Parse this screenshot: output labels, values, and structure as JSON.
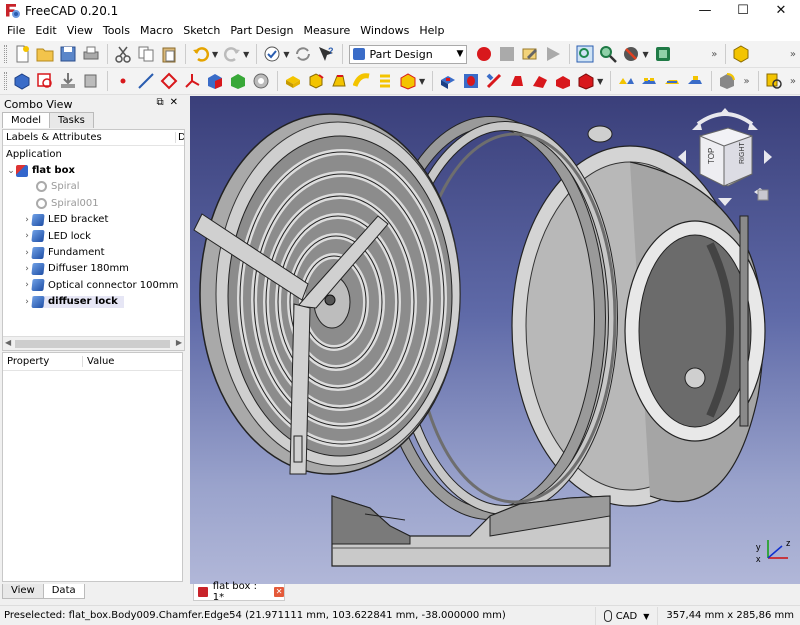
{
  "window": {
    "title": "FreeCAD 0.20.1"
  },
  "menu": [
    "File",
    "Edit",
    "View",
    "Tools",
    "Macro",
    "Sketch",
    "Part Design",
    "Measure",
    "Windows",
    "Help"
  ],
  "toolbar": {
    "workbench": "Part Design",
    "overflow": "»"
  },
  "combo": {
    "title": "Combo View",
    "tabs": [
      "Model",
      "Tasks"
    ],
    "tree_header": [
      "Labels & Attributes",
      "De"
    ],
    "section": "Application",
    "tree": [
      {
        "label": "flat box",
        "type": "document",
        "expanded": true,
        "bold": true
      },
      {
        "label": "Spiral",
        "type": "spiral",
        "muted": true
      },
      {
        "label": "Spiral001",
        "type": "spiral",
        "muted": true
      },
      {
        "label": "LED bracket",
        "type": "body"
      },
      {
        "label": "LED lock",
        "type": "body"
      },
      {
        "label": "Fundament",
        "type": "body"
      },
      {
        "label": "Diffuser 180mm",
        "type": "body"
      },
      {
        "label": "Optical connector 100mm",
        "type": "body"
      },
      {
        "label": "diffuser lock",
        "type": "body",
        "bold": true,
        "selected": true
      }
    ],
    "props_header": [
      "Property",
      "Value"
    ],
    "bottom_tabs": [
      "View",
      "Data"
    ]
  },
  "navcube": {
    "top": "TOP",
    "right": "RIGHT"
  },
  "doc_tab": {
    "label": "flat box : 1*",
    "close": "✕"
  },
  "status": {
    "message": "Preselected: flat_box.Body009.Chamfer.Edge54 (21.971111 mm, 103.622841 mm, -38.000000 mm)",
    "nav_style": "CAD",
    "dimensions": "357,44 mm x 285,86 mm"
  },
  "axes": {
    "x": "x",
    "y": "y",
    "z": "z"
  },
  "colors": {
    "accent_red": "#c8232a",
    "body_blue": "#2a5db0",
    "view_top": "#3a3f7a",
    "view_bottom": "#b1b7d8"
  }
}
